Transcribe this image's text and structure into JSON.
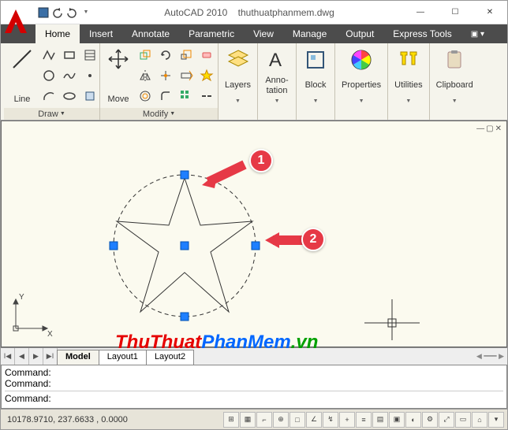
{
  "title": {
    "app": "AutoCAD 2010",
    "file": "thuthuatphanmem.dwg"
  },
  "tabs": [
    "Home",
    "Insert",
    "Annotate",
    "Parametric",
    "View",
    "Manage",
    "Output",
    "Express Tools"
  ],
  "activeTab": "Home",
  "ribbon": {
    "draw": {
      "label": "Draw",
      "line": "Line"
    },
    "modify": {
      "label": "Modify",
      "move": "Move"
    },
    "layers": "Layers",
    "annotation": "Anno-\ntation",
    "block": "Block",
    "properties": "Properties",
    "utilities": "Utilities",
    "clipboard": "Clipboard"
  },
  "modelTabs": {
    "items": [
      "Model",
      "Layout1",
      "Layout2"
    ],
    "active": "Model"
  },
  "command": {
    "prompt1": "Command:",
    "prompt2": "Command:",
    "prompt3": "Command:"
  },
  "status": {
    "coords": "10178.9710, 237.6633 , 0.0000"
  },
  "callouts": {
    "one": "1",
    "two": "2"
  },
  "watermark": {
    "p1": "ThuThuat",
    "p2": "PhanMem",
    "p3": ".vn"
  },
  "viewControls": {
    "min": "—",
    "max": "▢",
    "close": "✕"
  },
  "axis": {
    "y": "Y",
    "x": "X"
  }
}
